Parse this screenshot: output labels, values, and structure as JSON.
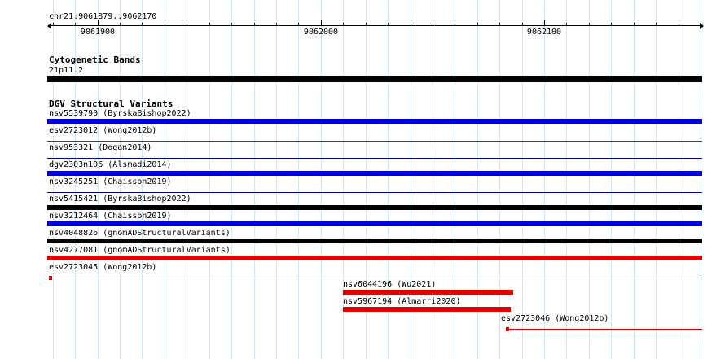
{
  "ruler": {
    "locus": "chr21:9061879..9062170",
    "start": 9061879,
    "end": 9062170,
    "major_ticks": [
      {
        "pos": 9061900,
        "label": "9061900"
      },
      {
        "pos": 9062000,
        "label": "9062000"
      },
      {
        "pos": 9062100,
        "label": "9062100"
      }
    ]
  },
  "cytoband": {
    "title": "Cytogenetic Bands",
    "label": "21p11.2",
    "color": "#000000",
    "start": 9061879,
    "end": 9062170
  },
  "dgv": {
    "title": "DGV Structural Variants",
    "features": [
      {
        "label": "nsv5539790 (ByrskaBishop2022)",
        "start": 9061879,
        "end": 9062170,
        "color": "#0000e6",
        "weight": "thick"
      },
      {
        "label": "esv2723012 (Wong2012b)",
        "start": 9061879,
        "end": 9062170,
        "color": "#e60000",
        "weight": "thin"
      },
      {
        "label": "nsv953321 (Dogan2014)",
        "start": 9061879,
        "end": 9062170,
        "color": "#000080",
        "weight": "thin"
      },
      {
        "label": "dgv2303n106 (Alsmadi2014)",
        "start": 9061879,
        "end": 9062170,
        "color": "#0000e6",
        "weight": "thick"
      },
      {
        "label": "nsv3245251 (Chaisson2019)",
        "start": 9061879,
        "end": 9062170,
        "color": "#000080",
        "weight": "thin"
      },
      {
        "label": "nsv5415421 (ByrskaBishop2022)",
        "start": 9061879,
        "end": 9062170,
        "color": "#000000",
        "weight": "thick"
      },
      {
        "label": "nsv3212464 (Chaisson2019)",
        "start": 9061879,
        "end": 9062170,
        "color": "#0000e6",
        "weight": "thick"
      },
      {
        "label": "nsv4048826 (gnomADStructuralVariants)",
        "start": 9061879,
        "end": 9062170,
        "color": "#000000",
        "weight": "thick"
      },
      {
        "label": "nsv4277081 (gnomADStructuralVariants)",
        "start": 9061879,
        "end": 9062170,
        "color": "#e60000",
        "weight": "thick"
      },
      {
        "label": "esv2723045 (Wong2012b)",
        "start": 9061879,
        "end": 9062170,
        "color": "#e60000",
        "weight": "thin",
        "start_box": true
      },
      {
        "label": "nsv6044196 (Wu2021)",
        "start": 9062010,
        "end": 9062086,
        "color": "#e60000",
        "weight": "thick"
      },
      {
        "label": "nsv5967194 (Almarri2020)",
        "start": 9062010,
        "end": 9062085,
        "color": "#e60000",
        "weight": "thick"
      },
      {
        "label": "esv2723046 (Wong2012b)",
        "start": 9062083,
        "end": 9062170,
        "color": "#e60000",
        "weight": "thin",
        "start_box": true
      }
    ]
  }
}
